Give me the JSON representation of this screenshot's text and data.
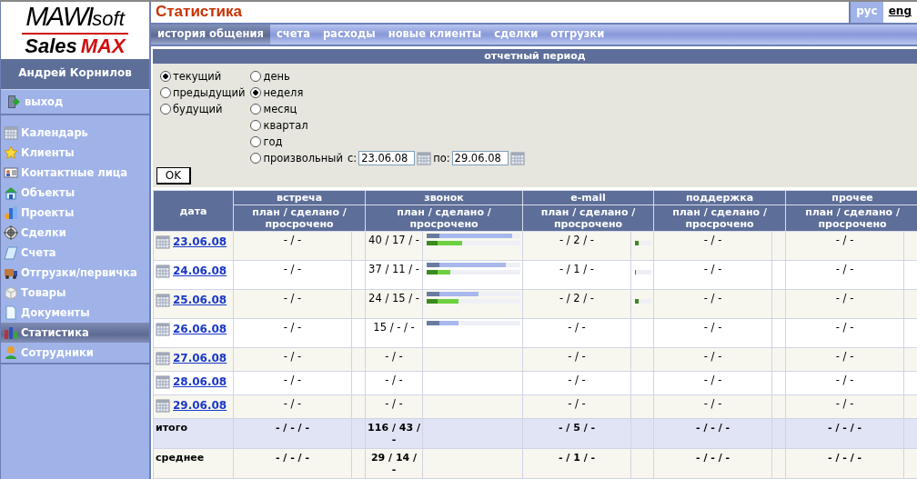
{
  "logo": {
    "top": "MAWI",
    "top_suffix": "soft",
    "bottom": "Sales",
    "bottom_accent": "MAX"
  },
  "user": "Андрей Корнилов",
  "logout": {
    "label": "выход"
  },
  "sidebar": {
    "items": [
      {
        "label": "Календарь",
        "selected": false
      },
      {
        "label": "Клиенты",
        "selected": false
      },
      {
        "label": "Контактные лица",
        "selected": false
      },
      {
        "label": "Объекты",
        "selected": false
      },
      {
        "label": "Проекты",
        "selected": false
      },
      {
        "label": "Сделки",
        "selected": false
      },
      {
        "label": "Счета",
        "selected": false
      },
      {
        "label": "Отгрузки/первичка",
        "selected": false
      },
      {
        "label": "Товары",
        "selected": false
      },
      {
        "label": "Документы",
        "selected": false
      },
      {
        "label": "Статистика",
        "selected": true
      },
      {
        "label": "Сотрудники",
        "selected": false
      }
    ]
  },
  "title": "Статистика",
  "languages": [
    {
      "label": "рус",
      "selected": true
    },
    {
      "label": "eng",
      "selected": false
    }
  ],
  "tabs": [
    {
      "label": "история общения",
      "selected": true
    },
    {
      "label": "счета",
      "selected": false
    },
    {
      "label": "расходы",
      "selected": false
    },
    {
      "label": "новые клиенты",
      "selected": false
    },
    {
      "label": "сделки",
      "selected": false
    },
    {
      "label": "отгрузки",
      "selected": false
    }
  ],
  "period": {
    "title": "отчетный период",
    "relative": [
      {
        "label": "текущий",
        "selected": true
      },
      {
        "label": "предыдущий",
        "selected": false
      },
      {
        "label": "будущий",
        "selected": false
      }
    ],
    "units": [
      {
        "label": "день",
        "selected": false
      },
      {
        "label": "неделя",
        "selected": true
      },
      {
        "label": "месяц",
        "selected": false
      },
      {
        "label": "квартал",
        "selected": false
      },
      {
        "label": "год",
        "selected": false
      },
      {
        "label": "произвольный",
        "selected": false
      }
    ],
    "from_label": "с:",
    "from": "23.06.08",
    "to_label": "по:",
    "to": "29.06.08",
    "ok": "OK"
  },
  "table": {
    "date_header": "дата",
    "columns": [
      {
        "title": "встреча",
        "sub": "план / сделано / просрочено"
      },
      {
        "title": "звонок",
        "sub": "план / сделано / просрочено"
      },
      {
        "title": "e-mail",
        "sub": "план / сделано / просрочено"
      },
      {
        "title": "поддержка",
        "sub": "план / сделано / просрочено"
      },
      {
        "title": "прочее",
        "sub": "план / сделано / просрочено"
      }
    ],
    "rows": [
      {
        "date": "23.06.08",
        "cells": [
          {
            "text": "- / -"
          },
          {
            "text": "40 / 17 / -",
            "bars": [
              {
                "kind": "plan",
                "level": 0.91
              },
              {
                "kind": "done",
                "level": 0.38
              }
            ]
          },
          {
            "text": "- / 2 / -",
            "bars": [
              {
                "kind": "done",
                "level": 0.2
              }
            ]
          },
          {
            "text": "- / -"
          },
          {
            "text": "- / -"
          }
        ]
      },
      {
        "date": "24.06.08",
        "cells": [
          {
            "text": "- / -"
          },
          {
            "text": "37 / 11 / -",
            "bars": [
              {
                "kind": "plan",
                "level": 0.84
              },
              {
                "kind": "done",
                "level": 0.25
              }
            ]
          },
          {
            "text": "- / 1 / -",
            "bars": [
              {
                "kind": "done",
                "level": 0.08
              }
            ]
          },
          {
            "text": "- / -"
          },
          {
            "text": "- / -"
          }
        ]
      },
      {
        "date": "25.06.08",
        "cells": [
          {
            "text": "- / -"
          },
          {
            "text": "24 / 15 / -",
            "bars": [
              {
                "kind": "plan",
                "level": 0.55
              },
              {
                "kind": "done",
                "level": 0.34
              }
            ]
          },
          {
            "text": "- / 2 / -",
            "bars": [
              {
                "kind": "done",
                "level": 0.2
              }
            ]
          },
          {
            "text": "- / -"
          },
          {
            "text": "- / -"
          }
        ]
      },
      {
        "date": "26.06.08",
        "cells": [
          {
            "text": "- / -"
          },
          {
            "text": "15 / - / -",
            "bars": [
              {
                "kind": "plan",
                "level": 0.34
              }
            ]
          },
          {
            "text": "- / -"
          },
          {
            "text": "- / -"
          },
          {
            "text": "- / -"
          }
        ]
      },
      {
        "date": "27.06.08",
        "cells": [
          {
            "text": "- / -"
          },
          {
            "text": "- / -"
          },
          {
            "text": "- / -"
          },
          {
            "text": "- / -"
          },
          {
            "text": "- / -"
          }
        ]
      },
      {
        "date": "28.06.08",
        "cells": [
          {
            "text": "- / -"
          },
          {
            "text": "- / -"
          },
          {
            "text": "- / -"
          },
          {
            "text": "- / -"
          },
          {
            "text": "- / -"
          }
        ]
      },
      {
        "date": "29.06.08",
        "cells": [
          {
            "text": "- / -"
          },
          {
            "text": "- / -"
          },
          {
            "text": "- / -"
          },
          {
            "text": "- / -"
          },
          {
            "text": "- / -"
          }
        ]
      }
    ],
    "summary": [
      {
        "label": "итого",
        "cells": [
          "- / - / -",
          "116 / 43 / -",
          "- / 5 / -",
          "- / - / -",
          "- / - / -"
        ]
      },
      {
        "label": "среднее",
        "cells": [
          "- / - / -",
          "29 / 14 / -",
          "- / 1 / -",
          "- / - / -",
          "- / - / -"
        ]
      }
    ]
  }
}
